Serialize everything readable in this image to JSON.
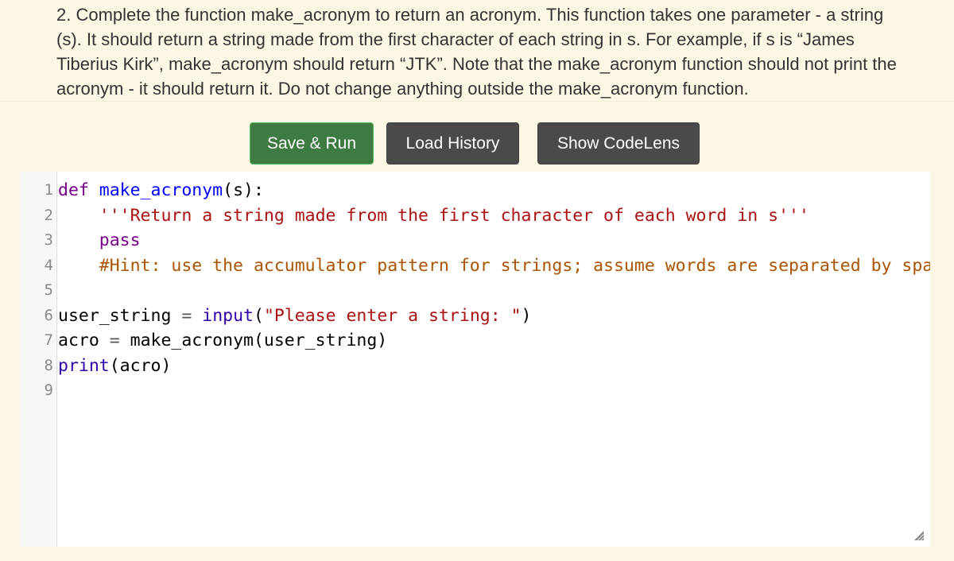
{
  "question": {
    "text": "2. Complete the function make_acronym to return an acronym. This function takes one parameter - a string (s). It should return a string made from the first character of each string in s. For example, if s is “James Tiberius Kirk”, make_acronym should return “JTK”. Note that the make_acronym function should not print the acronym - it should return it. Do not change anything outside the make_acronym function."
  },
  "toolbar": {
    "save_run_label": "Save & Run",
    "load_history_label": "Load History",
    "show_codelens_label": "Show CodeLens"
  },
  "colors": {
    "page_background": "#fcf6e4",
    "save_run": "#3e7b43",
    "dark_button": "#4a4a4a",
    "keyword": "#770088",
    "definition": "#0000ff",
    "string": "#aa1111",
    "comment": "#aa5500",
    "builtin": "#3300aa"
  },
  "editor": {
    "lines": [
      {
        "number": "1",
        "tokens": [
          {
            "t": "kw",
            "v": "def"
          },
          {
            "t": "plain",
            "v": " "
          },
          {
            "t": "def",
            "v": "make_acronym"
          },
          {
            "t": "plain",
            "v": "(s):"
          }
        ]
      },
      {
        "number": "2",
        "tokens": [
          {
            "t": "plain",
            "v": "    "
          },
          {
            "t": "str",
            "v": "'''Return a string made from the first character of each word in s'''"
          }
        ]
      },
      {
        "number": "3",
        "tokens": [
          {
            "t": "plain",
            "v": "    "
          },
          {
            "t": "kw",
            "v": "pass"
          }
        ]
      },
      {
        "number": "4",
        "tokens": [
          {
            "t": "plain",
            "v": "    "
          },
          {
            "t": "cmt",
            "v": "#Hint: use the accumulator pattern for strings; assume words are separated by spaces"
          }
        ]
      },
      {
        "number": "5",
        "tokens": []
      },
      {
        "number": "6",
        "tokens": [
          {
            "t": "plain",
            "v": "user_string "
          },
          {
            "t": "op",
            "v": "="
          },
          {
            "t": "plain",
            "v": " "
          },
          {
            "t": "builtin",
            "v": "input"
          },
          {
            "t": "plain",
            "v": "("
          },
          {
            "t": "str",
            "v": "\"Please enter a string: \""
          },
          {
            "t": "plain",
            "v": ")"
          }
        ]
      },
      {
        "number": "7",
        "tokens": [
          {
            "t": "plain",
            "v": "acro "
          },
          {
            "t": "op",
            "v": "="
          },
          {
            "t": "plain",
            "v": " make_acronym(user_string)"
          }
        ]
      },
      {
        "number": "8",
        "tokens": [
          {
            "t": "builtin",
            "v": "print"
          },
          {
            "t": "plain",
            "v": "(acro)"
          }
        ]
      },
      {
        "number": "9",
        "tokens": []
      }
    ]
  }
}
